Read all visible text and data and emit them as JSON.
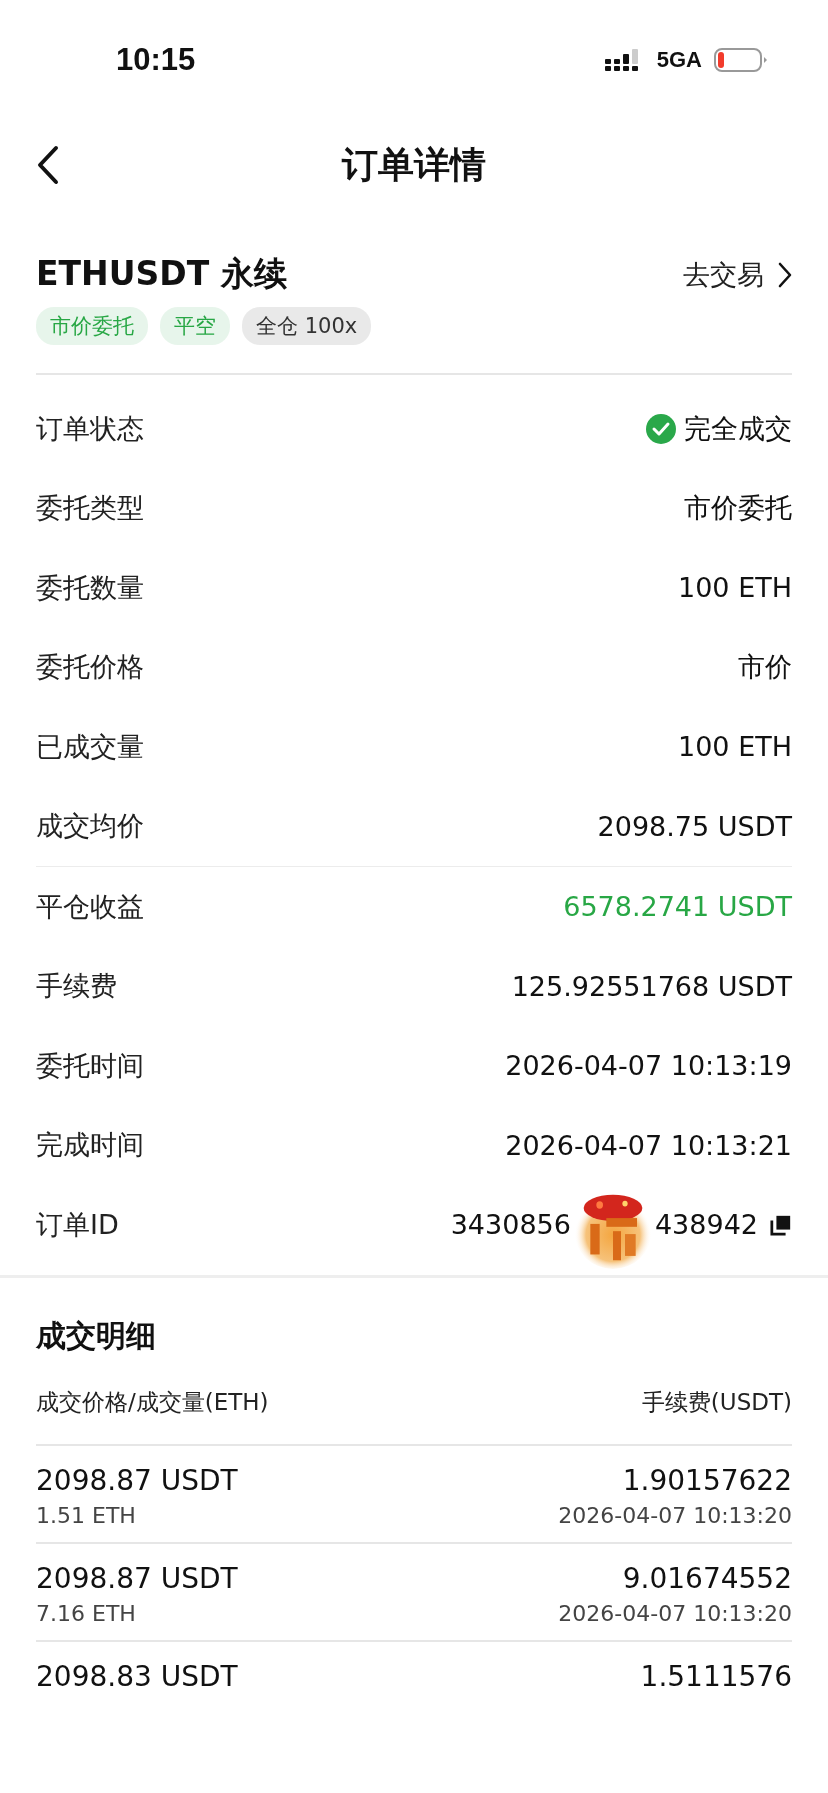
{
  "status_bar": {
    "time": "10:15",
    "network": "5GA",
    "battery_low": true
  },
  "header": {
    "title": "订单详情"
  },
  "contract": {
    "symbol": "ETHUSDT 永续",
    "action": "去交易",
    "tags": [
      {
        "label": "市价委托",
        "color": "#28a745"
      },
      {
        "label": "平空",
        "color": "#28a745"
      },
      {
        "label": "全仓 100x",
        "color": "#333333"
      }
    ]
  },
  "fields": [
    {
      "kind": "status",
      "label": "订单状态",
      "value": "完全成交"
    },
    {
      "kind": "plain",
      "label": "委托类型",
      "value": "市价委托"
    },
    {
      "kind": "plain",
      "label": "委托数量",
      "value": "100 ETH"
    },
    {
      "kind": "plain",
      "label": "委托价格",
      "value": "市价"
    },
    {
      "kind": "plain",
      "label": "已成交量",
      "value": "100 ETH"
    },
    {
      "kind": "plain",
      "label": "成交均价",
      "value": "2098.75 USDT",
      "divider_after": true
    },
    {
      "kind": "profit",
      "label": "平仓收益",
      "value": "6578.2741 USDT"
    },
    {
      "kind": "plain",
      "label": "手续费",
      "value": "125.92551768 USDT"
    },
    {
      "kind": "plain",
      "label": "委托时间",
      "value": "2026-04-07 10:13:19"
    },
    {
      "kind": "plain",
      "label": "完成时间",
      "value": "2026-04-07 10:13:21"
    },
    {
      "kind": "order_id",
      "label": "订单ID",
      "value_parts": [
        "3430856",
        "438942"
      ]
    }
  ],
  "trades": {
    "title": "成交明细",
    "column_1": "成交价格/成交量(ETH)",
    "column_2": "手续费(USDT)",
    "rows": [
      {
        "price": "2098.87 USDT",
        "amount": "1.51 ETH",
        "fee": "1.90157622",
        "time": "2026-04-07 10:13:20"
      },
      {
        "price": "2098.87 USDT",
        "amount": "7.16 ETH",
        "fee": "9.01674552",
        "time": "2026-04-07 10:13:20"
      },
      {
        "price": "2098.83 USDT",
        "fee": "1.5111576"
      }
    ]
  }
}
